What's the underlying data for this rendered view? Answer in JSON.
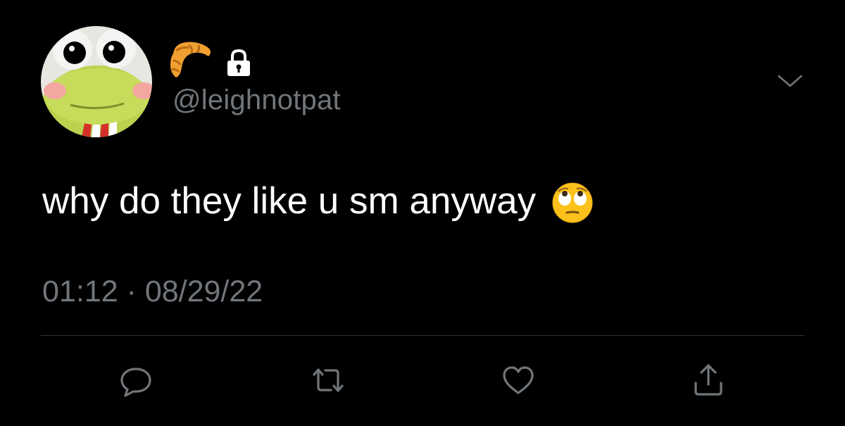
{
  "author": {
    "handle": "@leighnotpat",
    "name_emoji": "croissant",
    "protected": true,
    "avatar": "frog-avatar"
  },
  "tweet": {
    "text": "why do they like u sm anyway",
    "emoji": "face-with-rolling-eyes"
  },
  "meta": {
    "timestamp": "01:12 · 08/29/22"
  },
  "actions": {
    "reply": "reply-icon",
    "retweet": "retweet-icon",
    "like": "heart-icon",
    "share": "share-icon"
  },
  "colors": {
    "background": "#000000",
    "text": "#ffffff",
    "secondary": "#71767b",
    "divider": "#2f3336"
  }
}
